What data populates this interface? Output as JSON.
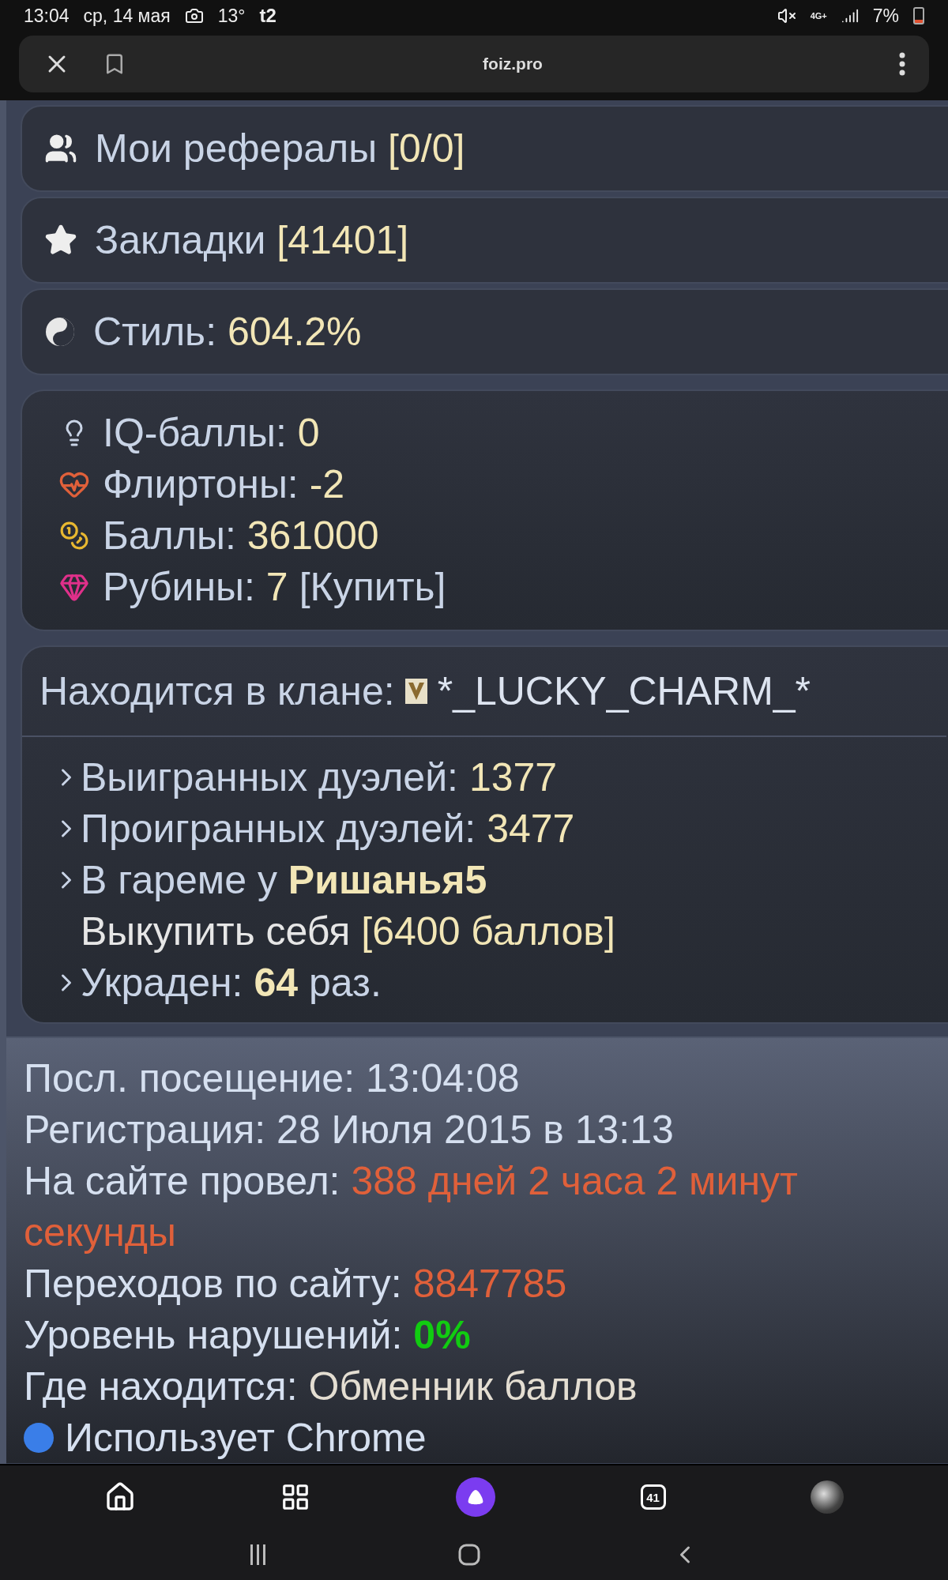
{
  "status_bar": {
    "time": "13:04",
    "date": "ср, 14 мая",
    "temperature": "13°",
    "carrier": "t2",
    "network": "4G+",
    "battery": "7%"
  },
  "browser": {
    "url": "foiz.pro"
  },
  "menu_cards": [
    {
      "label": "Мои рефералы",
      "value": "[0/0]"
    },
    {
      "label": "Закладки",
      "value": "[41401]"
    },
    {
      "label": "Стиль:",
      "value": "604.2%"
    }
  ],
  "stats": [
    {
      "label": "IQ-баллы:",
      "value": "0"
    },
    {
      "label": "Флиртоны:",
      "value": "-2"
    },
    {
      "label": "Баллы:",
      "value": "361000"
    },
    {
      "label": "Рубины:",
      "value": "7",
      "action": "[Купить]"
    }
  ],
  "clan": {
    "label": "Находится в клане:",
    "name": "*_LUCKY_CHARM_*",
    "rows": [
      {
        "kind": "stat",
        "label": "Выигранных дуэлей:",
        "value": "1377",
        "bold": false
      },
      {
        "kind": "stat",
        "label": "Проигранных дуэлей:",
        "value": "3477",
        "bold": false
      },
      {
        "kind": "stat",
        "label": "В гареме у",
        "value": "Ришанья5",
        "bold": true
      },
      {
        "kind": "link",
        "label": "Выкупить себя",
        "value": "[6400 баллов]",
        "bold": false
      },
      {
        "kind": "stat",
        "label": "Украден:",
        "value": "64",
        "suffix": "раз.",
        "bold": true
      }
    ]
  },
  "info": [
    {
      "label": "Посл. посещение:",
      "value": "13:04:08",
      "color": "#d6e0f0",
      "bold": false
    },
    {
      "label": "Регистрация:",
      "value": "28 Июля 2015 в 13:13",
      "color": "#d6e0f0",
      "bold": false
    },
    {
      "label": "На сайте провел:",
      "value": "388 дней 2 часа 2 минут",
      "color": "#e0603a",
      "bold": false
    },
    {
      "value": "секунды",
      "color": "#e0603a",
      "bold": false
    },
    {
      "label": "Переходов по сайту:",
      "value": "8847785",
      "color": "#e0603a",
      "bold": false
    },
    {
      "label": "Уровень нарушений:",
      "value": "0%",
      "color": "#11cc11",
      "bold": true
    },
    {
      "label": "Где находится:",
      "value": "Обменник баллов",
      "color": "#e4ded2",
      "bold": false
    },
    {
      "label": "Использует Chrome",
      "dot": true
    }
  ],
  "nav": {
    "tabs_count": "41"
  }
}
